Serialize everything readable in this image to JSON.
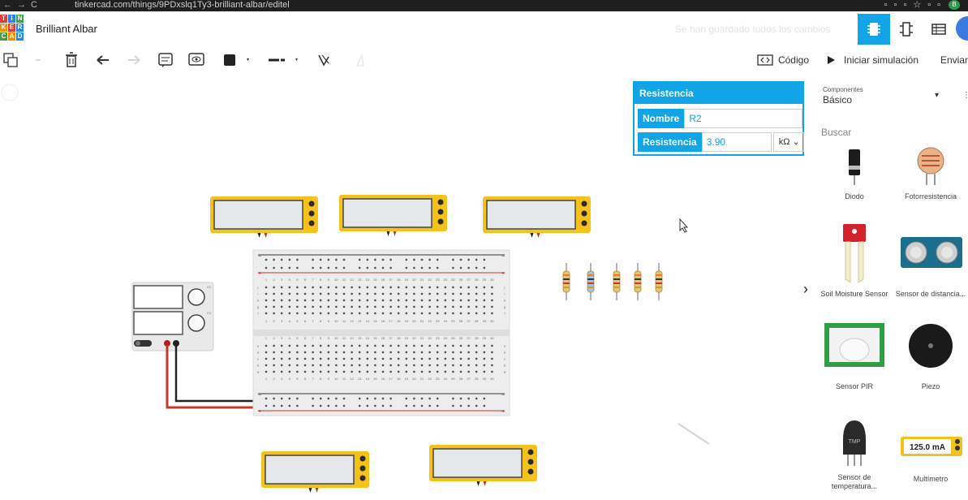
{
  "browser": {
    "url": "tinkercad.com/things/9PDxslq1Ty3-brilliant-albar/editel",
    "profile_initial": "B"
  },
  "app": {
    "logo_letters": [
      "T",
      "I",
      "N",
      "K",
      "E",
      "R",
      "C",
      "A",
      "D"
    ],
    "logo_colors": [
      "#e53935",
      "#1e88e5",
      "#43a047",
      "#fb8c00",
      "#e53935",
      "#1e88e5",
      "#43a047",
      "#fb8c00",
      "#1e88e5"
    ],
    "project_title": "Brilliant Albar",
    "save_status": "Se han guardado todos los cambios"
  },
  "toolbar": {
    "code_label": "Código",
    "simulate_label": "Iniciar simulación",
    "send_label": "Enviar"
  },
  "properties": {
    "title": "Resistencia",
    "name_label": "Nombre",
    "name_value": "R2",
    "resistance_label": "Resistencia",
    "resistance_value": "3.90",
    "resistance_unit": "kΩ"
  },
  "library": {
    "section_label": "Componentes",
    "category": "Básico",
    "search_label": "Buscar",
    "items": [
      {
        "label": "Diodo"
      },
      {
        "label": "Fotorresistencia"
      },
      {
        "label": "Soil Moisture Sensor"
      },
      {
        "label": "Sensor de distancia..."
      },
      {
        "label": "Sensor PIR"
      },
      {
        "label": "Piezo"
      },
      {
        "label": "Sensor de temperatura..."
      },
      {
        "label": "Multímetro"
      }
    ],
    "multimeter_reading": "125.0 mA"
  },
  "canvas": {
    "breadboard_columns": [
      "1",
      "2",
      "3",
      "4",
      "5",
      "6",
      "7",
      "8",
      "9",
      "10",
      "11",
      "12",
      "13",
      "14",
      "15",
      "16",
      "17",
      "18",
      "19",
      "20",
      "21",
      "22",
      "23",
      "24",
      "25",
      "26",
      "27",
      "28",
      "29",
      "30"
    ],
    "breadboard_rows_top": [
      "j",
      "i",
      "h",
      "g",
      "f"
    ],
    "breadboard_rows_bottom": [
      "e",
      "d",
      "c",
      "b",
      "a"
    ],
    "power_supply_knob_labels": [
      "CC",
      "CV"
    ],
    "colors": {
      "multimeter_yellow": "#f5c21b",
      "wire_red": "#c0392b",
      "wire_black": "#222222",
      "accent_blue": "#11a4e6"
    }
  }
}
